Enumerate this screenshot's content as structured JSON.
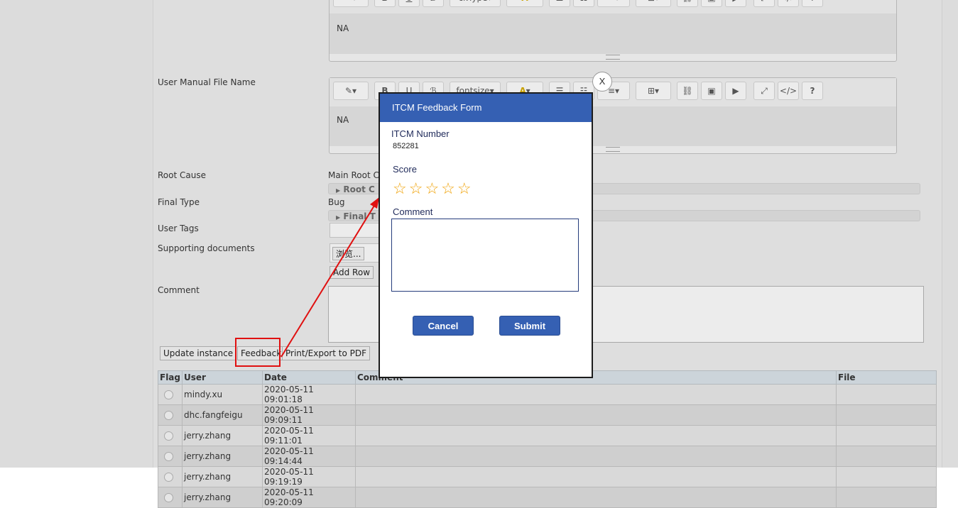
{
  "form": {
    "user_manual_label": "User Manual File Name",
    "top_editor_text": "NA",
    "top_editor_fontsize": "ckType",
    "manual_editor_text": "NA",
    "manual_editor_fontsize": "fontsize",
    "root_cause_label": "Root Cause",
    "main_root_cause_label": "Main Root Ca",
    "root_cause_section": "Root C",
    "final_type_label": "Final Type",
    "final_type_value": "Bug",
    "final_type_section": "Final T",
    "user_tags_label": "User Tags",
    "supporting_docs_label": "Supporting documents",
    "browse_button": "浏览...",
    "add_row_button": "Add Row",
    "comment_label": "Comment"
  },
  "actions": {
    "update_instance": "Update instance",
    "feedback": "Feedback",
    "print_export": "Print/Export to PDF"
  },
  "table": {
    "headers": [
      "Flag",
      "User",
      "Date",
      "Comment",
      "File"
    ],
    "rows": [
      {
        "user": "mindy.xu",
        "date": "2020-05-11 09:01:18",
        "comment": "",
        "file": ""
      },
      {
        "user": "dhc.fangfeigu",
        "date": "2020-05-11 09:09:11",
        "comment": "",
        "file": ""
      },
      {
        "user": "jerry.zhang",
        "date": "2020-05-11 09:11:01",
        "comment": "",
        "file": ""
      },
      {
        "user": "jerry.zhang",
        "date": "2020-05-11 09:14:44",
        "comment": "",
        "file": ""
      },
      {
        "user": "jerry.zhang",
        "date": "2020-05-11 09:19:19",
        "comment": "",
        "file": ""
      },
      {
        "user": "jerry.zhang",
        "date": "2020-05-11 09:20:09",
        "comment": "",
        "file": ""
      }
    ]
  },
  "modal": {
    "title": "ITCM Feedback Form",
    "close": "X",
    "itcm_number_label": "ITCM Number",
    "itcm_number_value": "852281",
    "score_label": "Score",
    "stars": "☆☆☆☆☆",
    "score_max": 5,
    "score_value": 0,
    "comment_label": "Comment",
    "comment_value": "",
    "cancel": "Cancel",
    "submit": "Submit"
  },
  "colors": {
    "modal_header": "#3560b3",
    "star": "#f0a30a",
    "annotation": "#e01010"
  }
}
